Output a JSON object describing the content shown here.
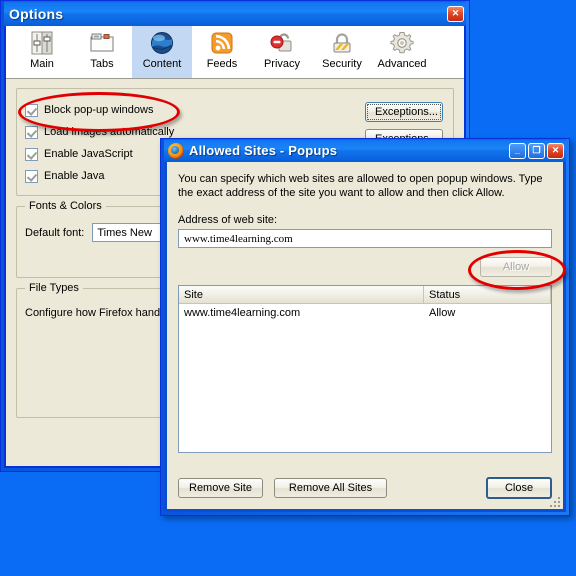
{
  "desktop": {
    "background": "#0A6CF5"
  },
  "options_window": {
    "title": "Options",
    "close_label": "✕",
    "tabs": [
      {
        "label": "Main",
        "icon": "sliders-icon",
        "selected": false
      },
      {
        "label": "Tabs",
        "icon": "tabs-icon",
        "selected": false
      },
      {
        "label": "Content",
        "icon": "globe-icon",
        "selected": true
      },
      {
        "label": "Feeds",
        "icon": "rss-icon",
        "selected": false
      },
      {
        "label": "Privacy",
        "icon": "privacy-icon",
        "selected": false
      },
      {
        "label": "Security",
        "icon": "padlock-icon",
        "selected": false
      },
      {
        "label": "Advanced",
        "icon": "gear-icon",
        "selected": false
      }
    ],
    "content": {
      "checkboxes": [
        {
          "label": "Block pop-up windows",
          "accel": "B",
          "checked": true
        },
        {
          "label": "Load images automatically",
          "accel": "i",
          "checked": true
        },
        {
          "label": "Enable JavaScript",
          "accel": "J",
          "checked": true
        },
        {
          "label": "Enable Java",
          "accel": "n",
          "checked": true
        }
      ],
      "exceptions_button_1": "Exceptions...",
      "exceptions_button_2": "Exceptions...",
      "fonts_group_title": "Fonts & Colors",
      "default_font_label": "Default font:",
      "default_font_value": "Times New",
      "filetypes_group_title": "File Types",
      "filetypes_text": "Configure how Firefox hand"
    }
  },
  "popups_window": {
    "title": "Allowed Sites - Popups",
    "icon": "firefox-icon",
    "minimize_label": "_",
    "maximize_label": "❐",
    "close_label": "✕",
    "description": "You can specify which web sites are allowed to open popup windows. Type the exact address of the site you want to allow and then click Allow.",
    "address_label": "Address of web site:",
    "address_value": "www.time4learning.com",
    "allow_button": "Allow",
    "allow_button_disabled": true,
    "list": {
      "columns": [
        "Site",
        "Status"
      ],
      "rows": [
        {
          "site": "www.time4learning.com",
          "status": "Allow"
        }
      ]
    },
    "buttons": {
      "remove_site": "Remove Site",
      "remove_all_sites": "Remove All Sites",
      "close": "Close"
    }
  },
  "annotations": {
    "color": "#E00000",
    "highlights": [
      "block-popups-checkbox",
      "allow-button"
    ]
  }
}
